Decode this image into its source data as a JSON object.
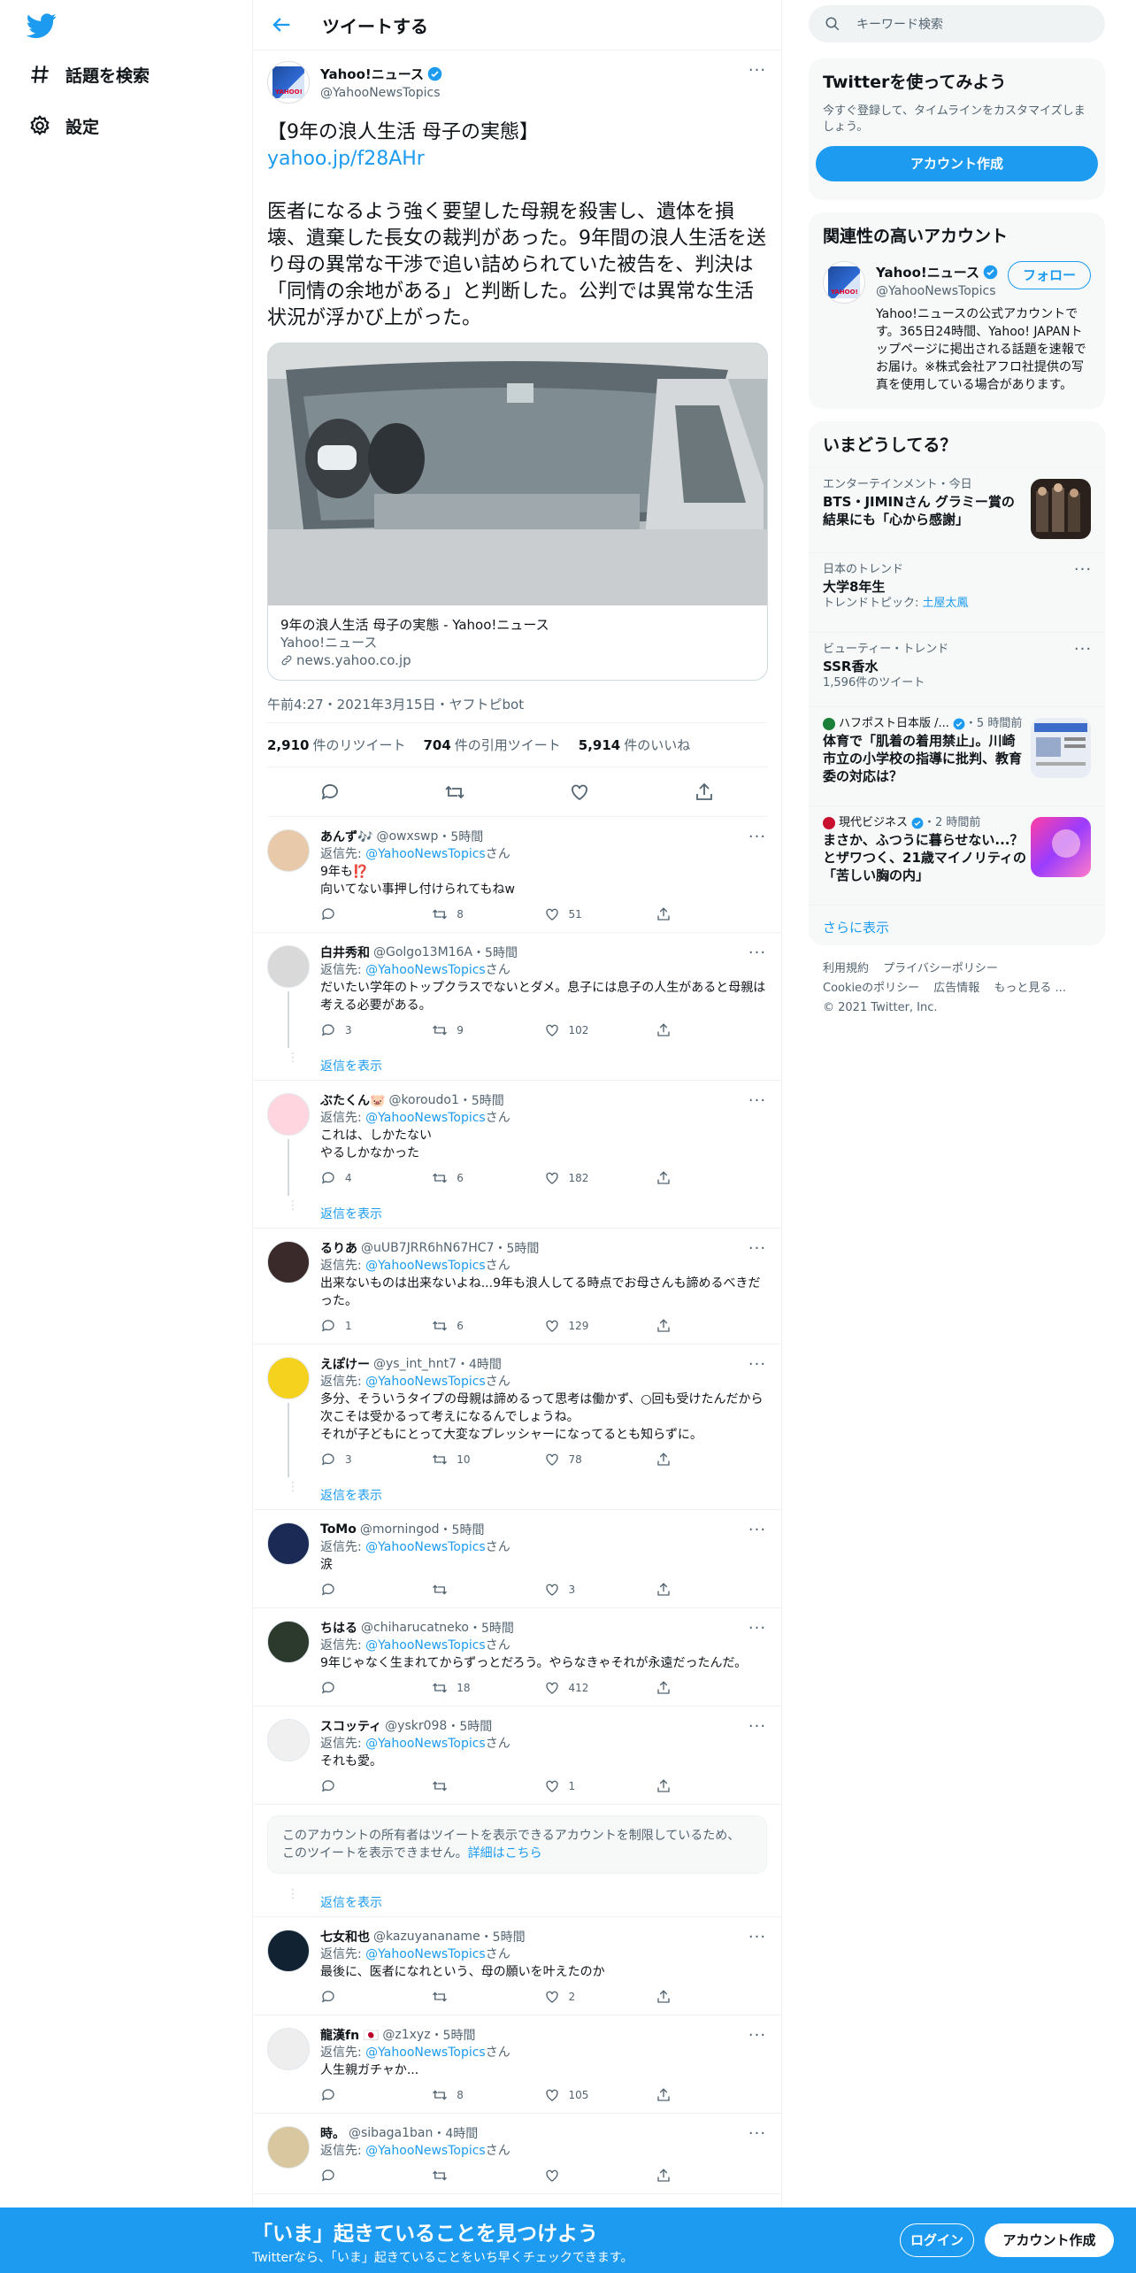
{
  "nav": {
    "items": [
      {
        "label": "話題を検索",
        "icon": "hashtag-icon"
      },
      {
        "label": "設定",
        "icon": "gear-icon"
      }
    ]
  },
  "header": {
    "title": "ツイートする"
  },
  "main_tweet": {
    "name": "Yahoo!ニュース",
    "handle": "@YahooNewsTopics",
    "text_head": "【9年の浪人生活 母子の実態】",
    "link": "yahoo.jp/f28AHr",
    "text_body": "医者になるよう強く要望した母親を殺害し、遺体を損壊、遺棄した長女の裁判があった。9年間の浪人生活を送り母の異常な干渉で追い詰められていた被告を、判決は「同情の余地がある」と判断した。公判では異常な生活状況が浮かび上がった。",
    "card": {
      "title": "9年の浪人生活 母子の実態 - Yahoo!ニュース",
      "source": "Yahoo!ニュース",
      "domain": "news.yahoo.co.jp"
    },
    "meta": "午前4:27・2021年3月15日・ヤフトピbot",
    "stats": {
      "retweets_num": "2,910",
      "retweets_label": "件のリツイート",
      "quotes_num": "704",
      "quotes_label": "件の引用ツイート",
      "likes_num": "5,914",
      "likes_label": "件のいいね"
    }
  },
  "reply_to_label": "返信先:",
  "reply_to_handle": "@YahooNewsTopics",
  "reply_to_suffix": "さん",
  "show_replies_label": "返信を表示",
  "replies": [
    {
      "name": "あんず🎶",
      "handle": "@owxswp",
      "time": "・5時間",
      "text": "9年も⁉️\n向いてない事押し付けられてもねw",
      "replies": "",
      "retweets": "8",
      "likes": "51",
      "show_replies": false
    },
    {
      "name": "白井秀和",
      "handle": "@Golgo13M16A",
      "time": "・5時間",
      "text": "だいたい学年のトップクラスでないとダメ。息子には息子の人生があると母親は考える必要がある。",
      "replies": "3",
      "retweets": "9",
      "likes": "102",
      "show_replies": true
    },
    {
      "name": "ぶたくん🐷",
      "handle": "@koroudo1",
      "time": "・5時間",
      "text": "これは、しかたない\nやるしかなかった",
      "replies": "4",
      "retweets": "6",
      "likes": "182",
      "show_replies": true
    },
    {
      "name": "るりあ",
      "handle": "@uUB7JRR6hN67HC7",
      "time": "・5時間",
      "text": "出来ないものは出来ないよね...9年も浪人してる時点でお母さんも諦めるべきだった。",
      "replies": "1",
      "retweets": "6",
      "likes": "129",
      "show_replies": false
    },
    {
      "name": "えぽけー",
      "handle": "@ys_int_hnt7",
      "time": "・4時間",
      "text": "多分、そういうタイプの母親は諦めるって思考は働かず、○回も受けたんだから次こそは受かるって考えになるんでしょうね。\nそれが子どもにとって大変なプレッシャーになってるとも知らずに。",
      "replies": "3",
      "retweets": "10",
      "likes": "78",
      "show_replies": true
    },
    {
      "name": "ToMo",
      "handle": "@morningod",
      "time": "・5時間",
      "text": "涙",
      "replies": "",
      "retweets": "",
      "likes": "3",
      "show_replies": false
    },
    {
      "name": "ちはる",
      "handle": "@chiharucatneko",
      "time": "・5時間",
      "text": "9年じゃなく生まれてからずっとだろう。やらなきゃそれが永遠だったんだ。",
      "replies": "",
      "retweets": "18",
      "likes": "412",
      "show_replies": false
    },
    {
      "name": "スコッティ",
      "handle": "@yskr098",
      "time": "・5時間",
      "text": "それも愛。",
      "replies": "",
      "retweets": "",
      "likes": "1",
      "show_replies": false
    }
  ],
  "restricted": {
    "text": "このアカウントの所有者はツイートを表示できるアカウントを制限しているため、このツイートを表示できません。",
    "link": "詳細はこちら"
  },
  "replies2": [
    {
      "name": "七女和也",
      "handle": "@kazuyananame",
      "time": "・5時間",
      "text": "最後に、医者になれという、母の願いを叶えたのか",
      "replies": "",
      "retweets": "",
      "likes": "2"
    },
    {
      "name": "龍漢fn 🇯🇵",
      "handle": "@z1xyz",
      "time": "・5時間",
      "text": "人生親ガチャか...",
      "replies": "",
      "retweets": "8",
      "likes": "105"
    },
    {
      "name": "時。",
      "handle": "@sibaga1ban",
      "time": "・4時間",
      "text": "",
      "replies": "",
      "retweets": "",
      "likes": ""
    }
  ],
  "right": {
    "search_placeholder": "キーワード検索",
    "signup_panel": {
      "title": "Twitterを使ってみよう",
      "desc": "今すぐ登録して、タイムラインをカスタマイズしましょう。",
      "button": "アカウント作成"
    },
    "related": {
      "title": "関連性の高いアカウント",
      "name": "Yahoo!ニュース",
      "handle": "@YahooNewsTopics",
      "follow": "フォロー",
      "bio": "Yahoo!ニュースの公式アカウントです。365日24時間、Yahoo! JAPANトップページに掲出される話題を速報でお届け。※株式会社アフロ社提供の写真を使用している場合があります。"
    },
    "trends": {
      "title": "いまどうしてる？",
      "items": [
        {
          "category": "エンターテインメント・今日",
          "title": "BTS・JIMINさん グラミー賞の結果にも「心から感謝」",
          "sub": ""
        },
        {
          "category": "日本のトレンド",
          "title": "大学8年生",
          "sub": "トレンドトピック:",
          "sub_link": "土屋太鳳"
        },
        {
          "category": "ビューティー・トレンド",
          "title": "SSR香水",
          "sub": "1,596件のツイート"
        },
        {
          "category": "ハフポスト日本版 /...",
          "category_time": "・5 時間前",
          "title": "体育で「肌着の着用禁止」。川崎市立の小学校の指導に批判、教育委の対応は？",
          "sub": ""
        },
        {
          "category": "現代ビジネス",
          "category_time": "・2 時間前",
          "title": "まさか、ふつうに暮らせない...？とザワつく、21歳マイノリティの「苦しい胸の内」",
          "sub": ""
        }
      ],
      "show_more": "さらに表示"
    },
    "footer": {
      "links": [
        "利用規約",
        "プライバシーポリシー",
        "Cookieのポリシー",
        "広告情報",
        "もっと見る ..."
      ],
      "copyright": "© 2021 Twitter, Inc."
    }
  },
  "bottom_bar": {
    "title": "「いま」起きていることを見つけよう",
    "subtitle": "Twitterなら、「いま」起きていることをいち早くチェックできます。",
    "login": "ログイン",
    "signup": "アカウント作成"
  },
  "colors": {
    "accent": "#1d9bf0",
    "text": "#0f1419",
    "muted": "#536471"
  }
}
